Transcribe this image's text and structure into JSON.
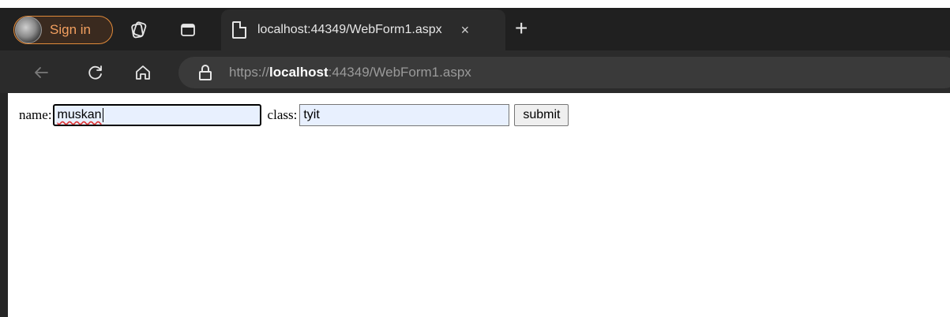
{
  "browser": {
    "profile": {
      "signin_label": "Sign in"
    },
    "tab": {
      "title": "localhost:44349/WebForm1.aspx",
      "close_glyph": "×"
    },
    "new_tab_glyph": "+",
    "address": {
      "scheme": "https://",
      "host": "localhost",
      "rest": ":44349/WebForm1.aspx"
    },
    "icons": {
      "workspaces": "workspaces-icon",
      "tab_actions": "tab-actions-icon",
      "page": "page-icon",
      "back": "back-arrow-icon",
      "reload": "reload-icon",
      "home": "home-icon",
      "lock": "lock-icon"
    },
    "colors": {
      "signin_accent": "#e08a3a",
      "toolbar_bg": "#202020",
      "address_bg": "#2b2b2b",
      "autofill_bg": "#e8f0fe"
    }
  },
  "form": {
    "name_label": "name:",
    "name_value": "muskan",
    "class_label": "class:",
    "class_value": "tyit",
    "submit_label": "submit"
  }
}
